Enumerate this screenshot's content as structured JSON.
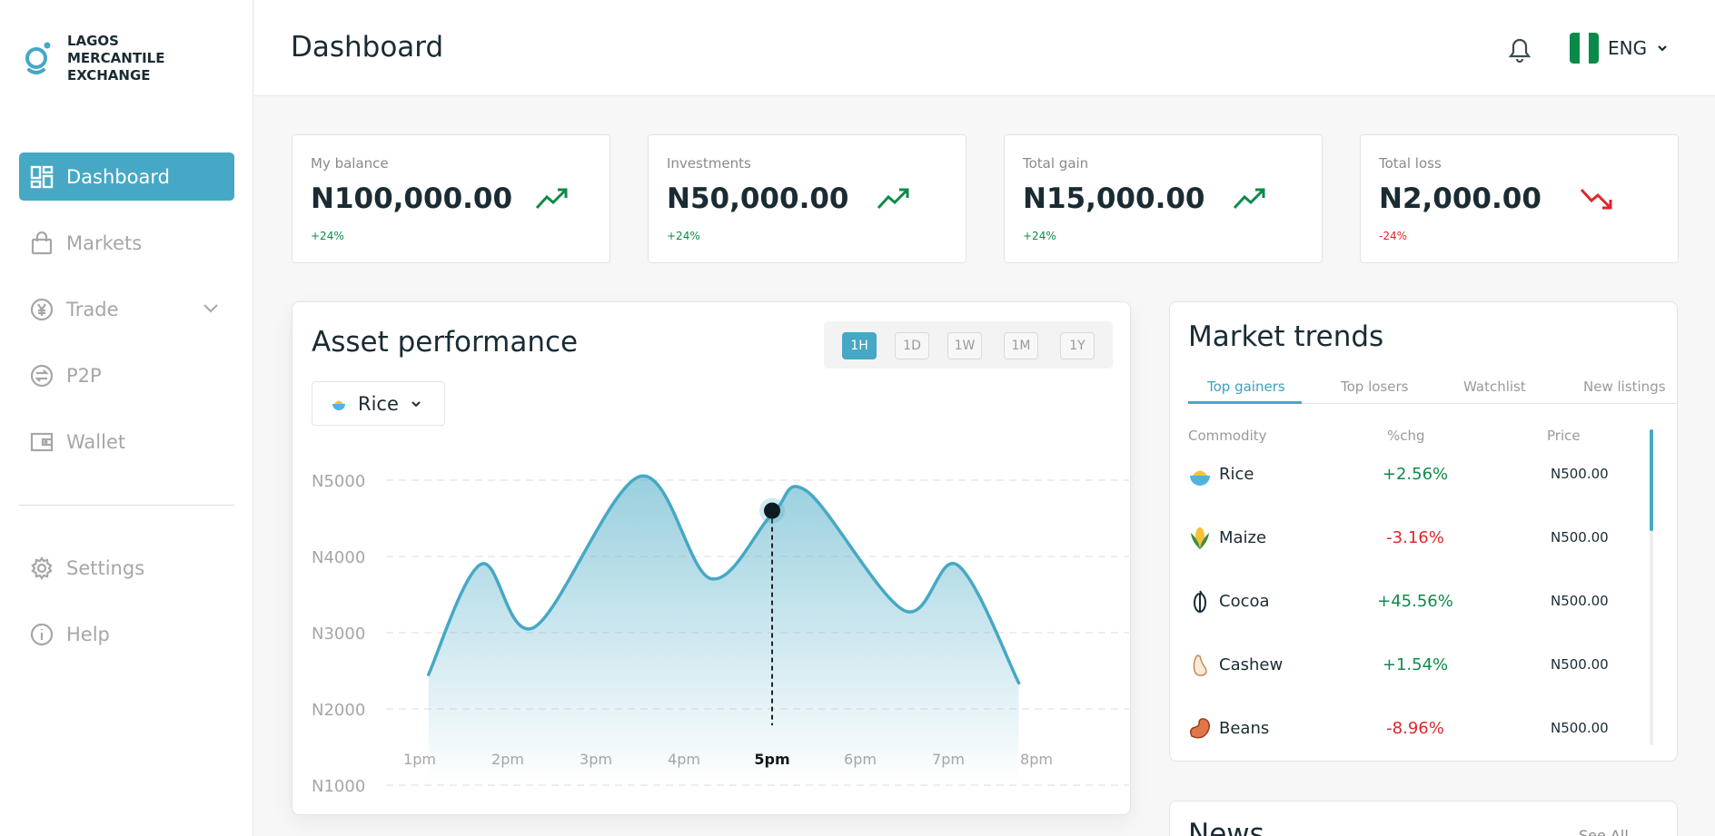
{
  "brand": {
    "line1": "LAGOS",
    "line2": "MERCANTILE EXCHANGE"
  },
  "nav": {
    "items": [
      {
        "label": "Dashboard",
        "icon": "dashboard-grid-icon",
        "active": true
      },
      {
        "label": "Markets",
        "icon": "shopping-bag-icon"
      },
      {
        "label": "Trade",
        "icon": "yen-circle-icon"
      },
      {
        "label": "P2P",
        "icon": "exchange-circle-icon"
      },
      {
        "label": "Wallet",
        "icon": "wallet-icon"
      }
    ],
    "secondary": [
      {
        "label": "Settings",
        "icon": "gear-icon"
      },
      {
        "label": "Help",
        "icon": "info-icon"
      }
    ]
  },
  "header": {
    "title": "Dashboard",
    "language": "ENG"
  },
  "colors": {
    "accent": "#46a8c4",
    "positive": "#0f8a4a",
    "negative": "#e0262b"
  },
  "stats": [
    {
      "label": "My balance",
      "value": "N100,000.00",
      "change": "+24%",
      "trend": "up"
    },
    {
      "label": "Investments",
      "value": "N50,000.00",
      "change": "+24%",
      "trend": "up"
    },
    {
      "label": "Total gain",
      "value": "N15,000.00",
      "change": "+24%",
      "trend": "up"
    },
    {
      "label": "Total loss",
      "value": "N2,000.00",
      "change": "-24%",
      "trend": "down"
    }
  ],
  "performance": {
    "title": "Asset performance",
    "ranges": [
      "1H",
      "1D",
      "1W",
      "1M",
      "1Y"
    ],
    "active_range": "1H",
    "commodity": "Rice"
  },
  "chart_data": {
    "type": "area",
    "x": [
      "1pm",
      "2pm",
      "3pm",
      "4pm",
      "5pm",
      "6pm",
      "7pm",
      "8pm"
    ],
    "y_ticks": [
      "N5000",
      "N4000",
      "N3000",
      "N2000",
      "N1000"
    ],
    "ylim": [
      1000,
      5000
    ],
    "highlighted_x": "5pm",
    "points": [
      [
        0.1,
        2450
      ],
      [
        0.7,
        3900
      ],
      [
        1.3,
        3070
      ],
      [
        2.5,
        5050
      ],
      [
        3.3,
        3710
      ],
      [
        4.0,
        4550
      ],
      [
        4.4,
        4850
      ],
      [
        5.5,
        3290
      ],
      [
        6.1,
        3890
      ],
      [
        6.8,
        2340
      ]
    ],
    "marker": {
      "x": 4.0,
      "y": 4600
    },
    "grid": true
  },
  "trends": {
    "title": "Market trends",
    "tabs": [
      "Top gainers",
      "Top losers",
      "Watchlist",
      "New listings"
    ],
    "headers": {
      "commodity": "Commodity",
      "change": "%chg",
      "price": "Price"
    },
    "rows": [
      {
        "name": "Rice",
        "change": "+2.56%",
        "price": "N500.00",
        "dir": "up",
        "icon": "rice-bowl-icon"
      },
      {
        "name": "Maize",
        "change": "-3.16%",
        "price": "N500.00",
        "dir": "down",
        "icon": "maize-icon"
      },
      {
        "name": "Cocoa",
        "change": "+45.56%",
        "price": "N500.00",
        "dir": "up",
        "icon": "cocoa-icon"
      },
      {
        "name": "Cashew",
        "change": "+1.54%",
        "price": "N500.00",
        "dir": "up",
        "icon": "cashew-icon"
      },
      {
        "name": "Beans",
        "change": "-8.96%",
        "price": "N500.00",
        "dir": "down",
        "icon": "beans-icon"
      }
    ]
  },
  "news": {
    "title": "News",
    "see_all": "See All"
  }
}
